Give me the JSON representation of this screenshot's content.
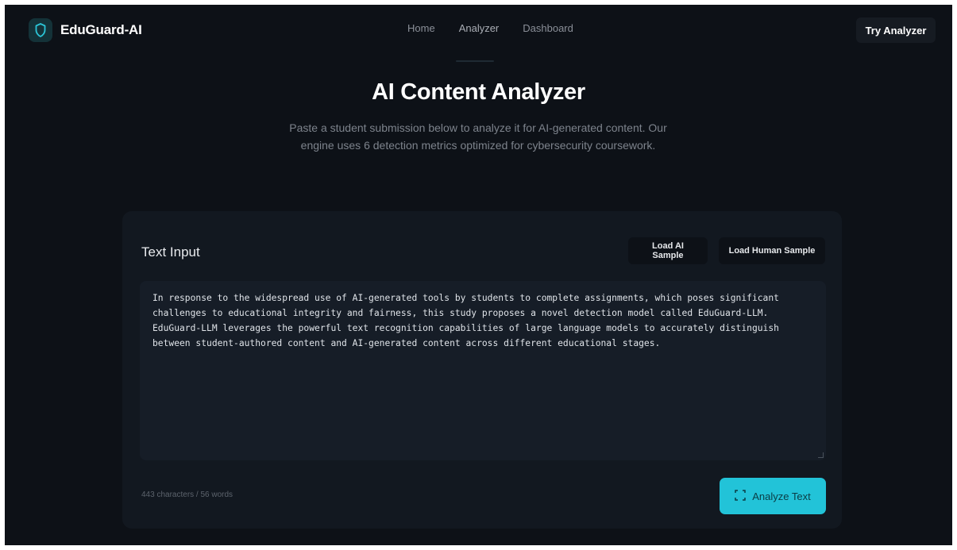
{
  "nav": {
    "brand": "EduGuard-AI",
    "links": [
      {
        "label": "Home"
      },
      {
        "label": "Analyzer"
      },
      {
        "label": "Dashboard"
      }
    ],
    "active_link": "Analyzer",
    "cta_label": "Try Analyzer"
  },
  "hero": {
    "title": "AI Content Analyzer",
    "subtitle": "Paste a student submission below to analyze it for AI-generated content. Our engine uses 6 detection metrics optimized for cybersecurity coursework."
  },
  "input_card": {
    "title": "Text Input",
    "load_ai_label": "Load AI Sample",
    "load_human_label": "Load Human Sample",
    "text_value": "In response to the widespread use of AI-generated tools by students to complete assignments, which poses significant challenges to educational integrity and fairness, this study proposes a novel detection model called EduGuard-LLM. EduGuard-LLM leverages the powerful text recognition capabilities of large language models to accurately distinguish between student-authored content and AI-generated content across different educational stages.",
    "counter": "443 characters / 56 words",
    "analyze_label": "Analyze Text"
  },
  "colors": {
    "background": "#0d1117",
    "card": "#121820",
    "accent": "#22c3d8"
  },
  "icons": {
    "brand": "shield-icon",
    "analyze": "scan-icon"
  }
}
